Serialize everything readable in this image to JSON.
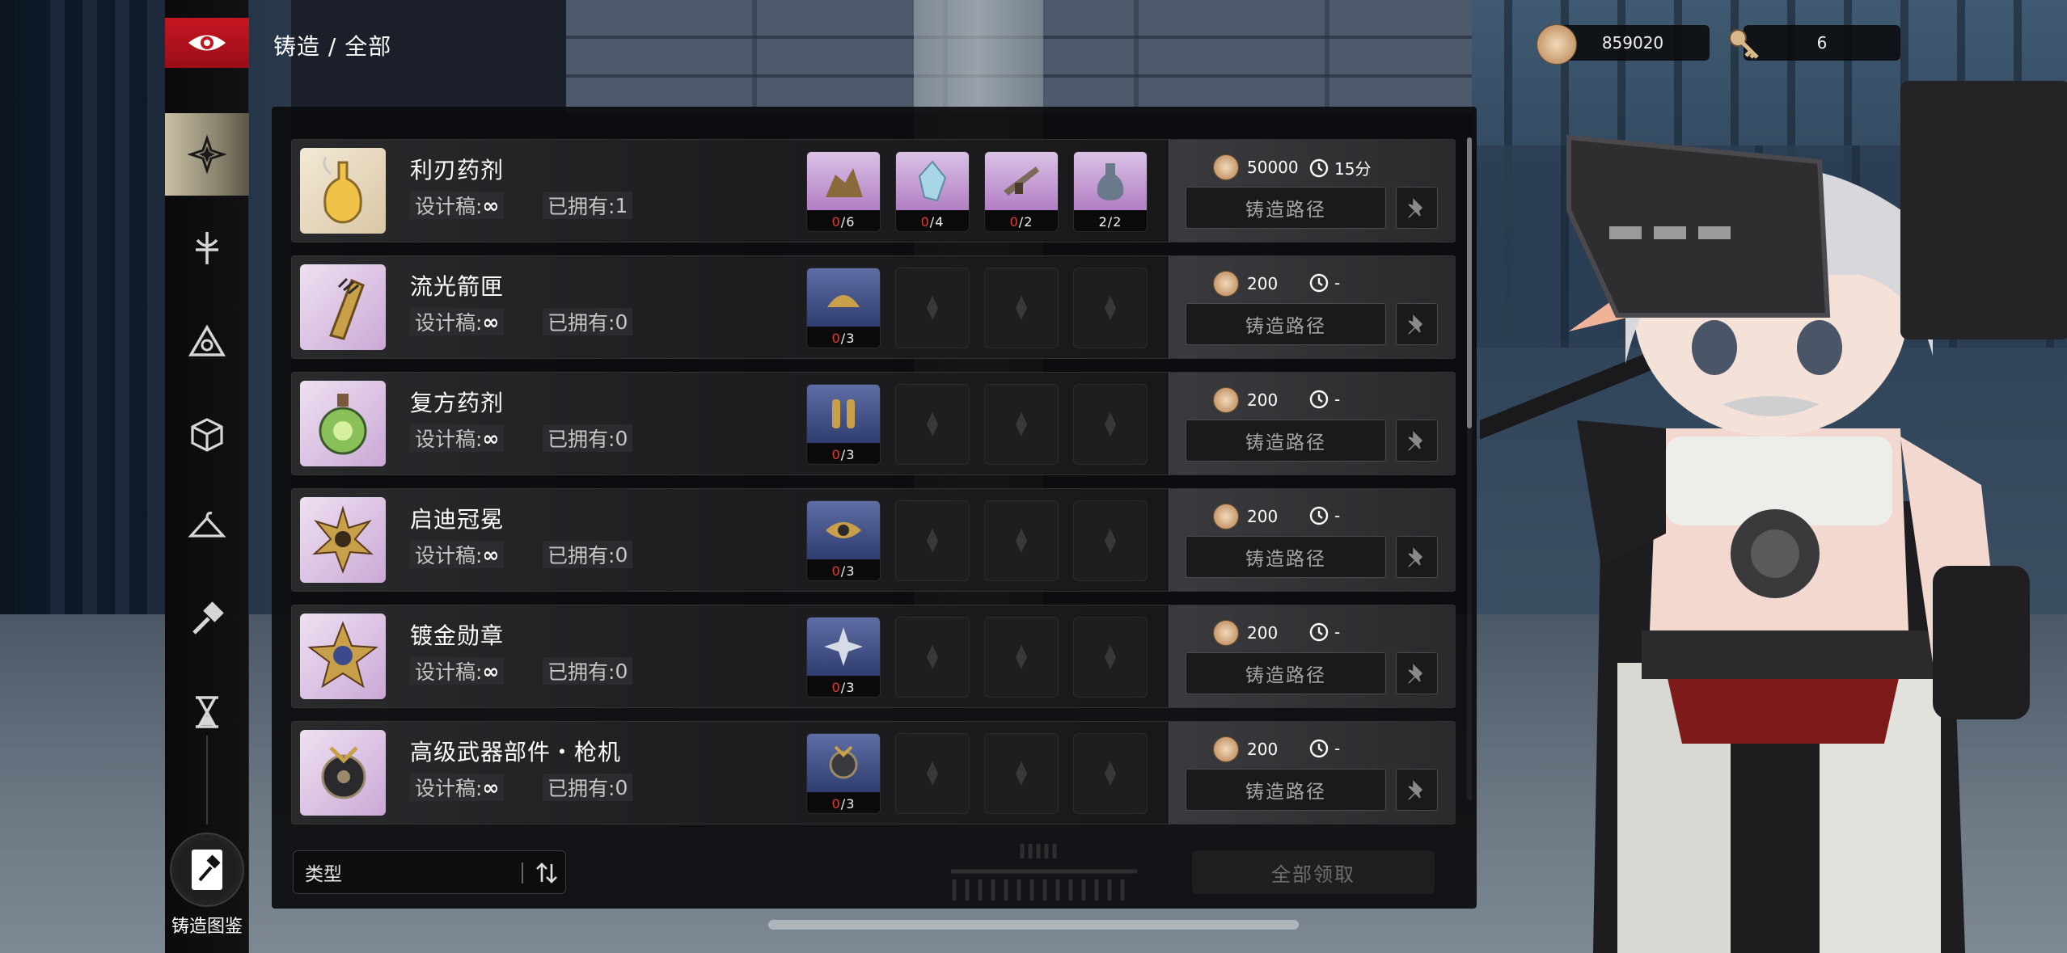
{
  "header": {
    "breadcrumb": "铸造 / 全部",
    "currencies": [
      {
        "icon": "coin-icon",
        "value": "859020"
      },
      {
        "icon": "key-icon",
        "value": "6"
      }
    ]
  },
  "nav": {
    "logo_icon": "eye-emblem-icon",
    "items": [
      {
        "icon": "all-categories-icon",
        "active": true
      },
      {
        "icon": "weapon-icon",
        "active": false
      },
      {
        "icon": "triangle-rune-icon",
        "active": false
      },
      {
        "icon": "cube-icon",
        "active": false
      },
      {
        "icon": "hanger-icon",
        "active": false
      },
      {
        "icon": "hammer-icon",
        "active": false
      },
      {
        "icon": "hourglass-icon",
        "active": false
      }
    ],
    "atlas_label": "铸造图鉴"
  },
  "recipes": [
    {
      "name": "利刃药剂",
      "blueprint_label": "设计稿:",
      "blueprint_value": "∞",
      "owned_label": "已拥有:",
      "owned_value": "1",
      "materials": [
        {
          "state": "filled",
          "have": "0",
          "need": "/6"
        },
        {
          "state": "filled",
          "have": "0",
          "need": "/4"
        },
        {
          "state": "filled",
          "have": "0",
          "need": "/2"
        },
        {
          "state": "filled",
          "have": "2",
          "need": "/2"
        }
      ],
      "cost": "50000",
      "time": "15分",
      "path_label": "铸造路径"
    },
    {
      "name": "流光箭匣",
      "blueprint_label": "设计稿:",
      "blueprint_value": "∞",
      "owned_label": "已拥有:",
      "owned_value": "0",
      "materials": [
        {
          "state": "filled",
          "have": "0",
          "need": "/3"
        },
        {
          "state": "empty"
        },
        {
          "state": "empty"
        },
        {
          "state": "empty"
        }
      ],
      "cost": "200",
      "time": "-",
      "path_label": "铸造路径"
    },
    {
      "name": "复方药剂",
      "blueprint_label": "设计稿:",
      "blueprint_value": "∞",
      "owned_label": "已拥有:",
      "owned_value": "0",
      "materials": [
        {
          "state": "filled",
          "have": "0",
          "need": "/3"
        },
        {
          "state": "empty"
        },
        {
          "state": "empty"
        },
        {
          "state": "empty"
        }
      ],
      "cost": "200",
      "time": "-",
      "path_label": "铸造路径"
    },
    {
      "name": "启迪冠冕",
      "blueprint_label": "设计稿:",
      "blueprint_value": "∞",
      "owned_label": "已拥有:",
      "owned_value": "0",
      "materials": [
        {
          "state": "filled",
          "have": "0",
          "need": "/3"
        },
        {
          "state": "empty"
        },
        {
          "state": "empty"
        },
        {
          "state": "empty"
        }
      ],
      "cost": "200",
      "time": "-",
      "path_label": "铸造路径"
    },
    {
      "name": "镀金勋章",
      "blueprint_label": "设计稿:",
      "blueprint_value": "∞",
      "owned_label": "已拥有:",
      "owned_value": "0",
      "materials": [
        {
          "state": "filled",
          "have": "0",
          "need": "/3"
        },
        {
          "state": "empty"
        },
        {
          "state": "empty"
        },
        {
          "state": "empty"
        }
      ],
      "cost": "200",
      "time": "-",
      "path_label": "铸造路径"
    },
    {
      "name": "高级武器部件・枪机",
      "blueprint_label": "设计稿:",
      "blueprint_value": "∞",
      "owned_label": "已拥有:",
      "owned_value": "0",
      "materials": [
        {
          "state": "filled",
          "have": "0",
          "need": "/3"
        },
        {
          "state": "empty"
        },
        {
          "state": "empty"
        },
        {
          "state": "empty"
        }
      ],
      "cost": "200",
      "time": "-",
      "path_label": "铸造路径"
    }
  ],
  "footer": {
    "filter_label": "类型",
    "claim_all_label": "全部领取"
  },
  "colors": {
    "accent_red": "#c41622",
    "material_purple": "#b27fc4",
    "material_blue": "#2f3c6e",
    "insufficient": "#e23a3a"
  }
}
